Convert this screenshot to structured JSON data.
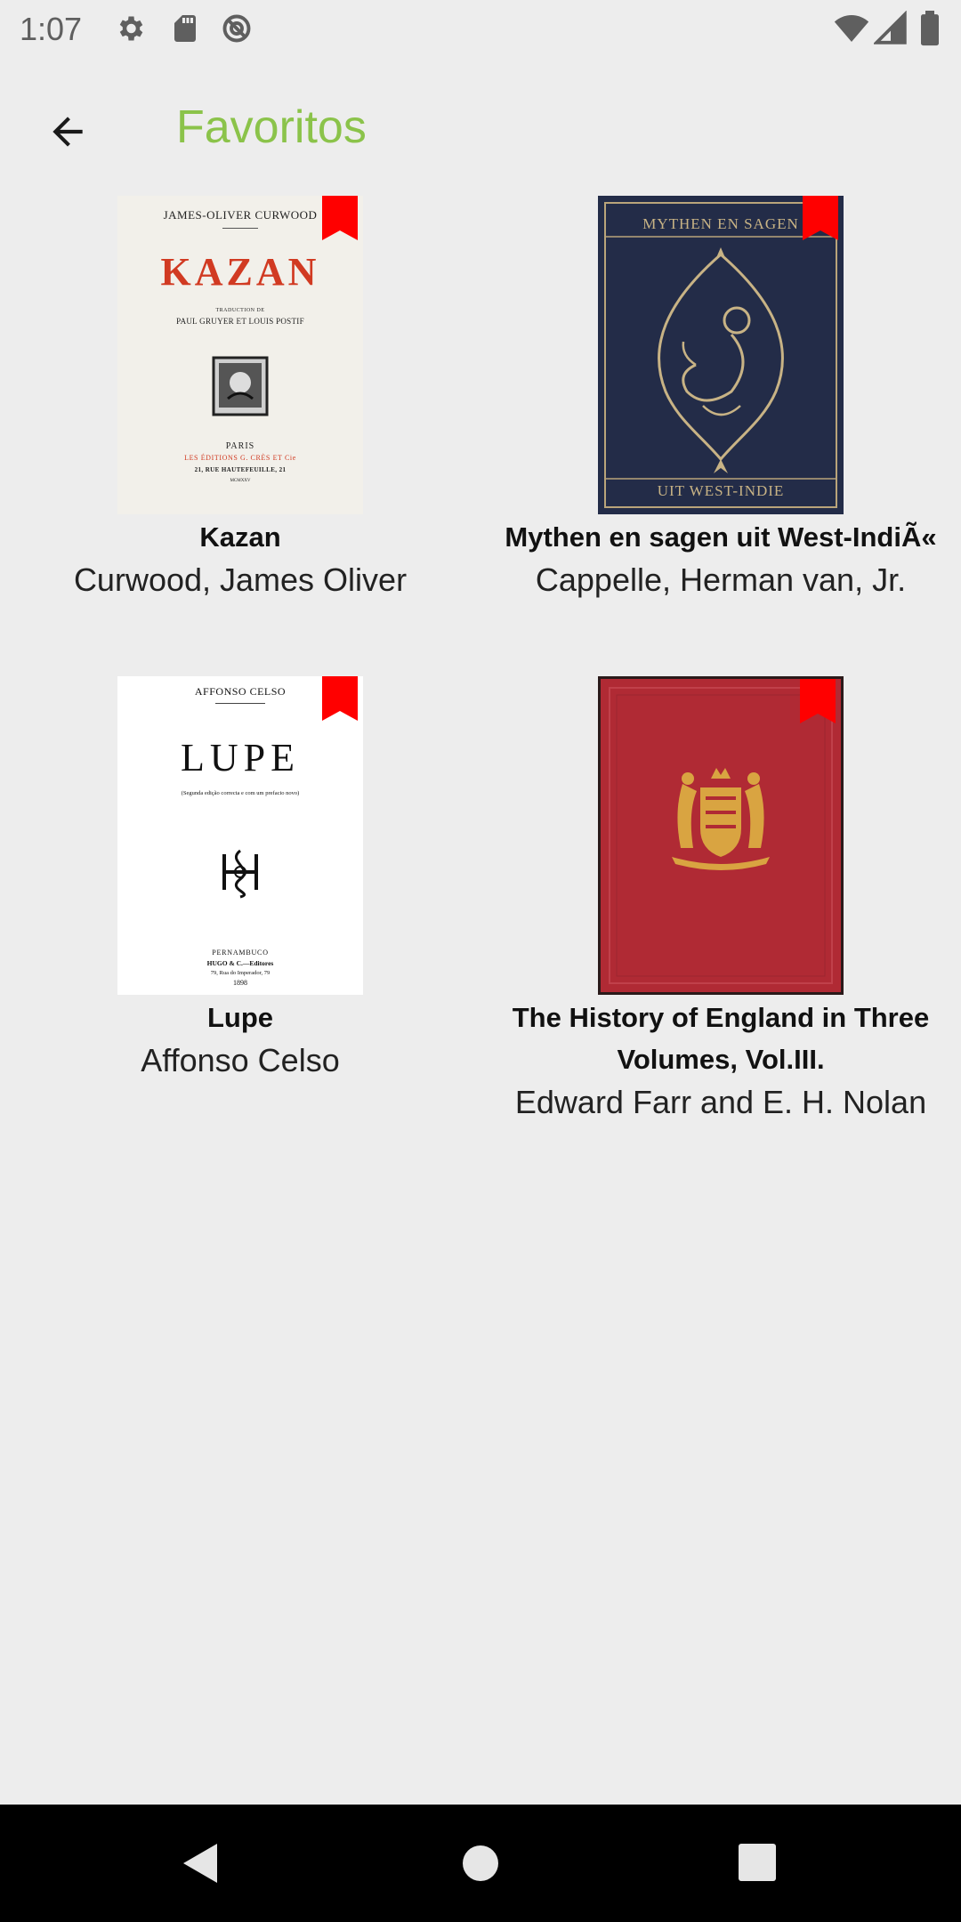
{
  "status_bar": {
    "time": "1:07",
    "icons": [
      "gear-icon",
      "sd-card-icon",
      "do-not-disturb-icon",
      "wifi-icon",
      "signal-icon",
      "battery-icon"
    ]
  },
  "app_bar": {
    "title": "Favoritos",
    "back_icon": "arrow-back-icon",
    "title_color": "#8bc34a"
  },
  "bookmark_color": "#ff0000",
  "books": [
    {
      "title": "Kazan",
      "author": "Curwood, James Oliver",
      "cover": {
        "author_line": "JAMES-OLIVER CURWOOD",
        "title_line": "KAZAN",
        "translator_1": "TRADUCTION DE",
        "translator_2": "PAUL GRUYER ET LOUIS POSTIF",
        "city": "PARIS",
        "publisher": "LES ÉDITIONS G. CRÈS ET Cie",
        "address": "21, RUE HAUTEFEUILLE, 21",
        "year": "MCMXXV"
      }
    },
    {
      "title": "Mythen en sagen uit West-IndiÃ«",
      "author": "Cappelle, Herman van, Jr.",
      "cover": {
        "top_line": "MYTHEN EN SAGEN",
        "bottom_line": "UIT WEST-INDIE"
      }
    },
    {
      "title": "Lupe",
      "author": "Affonso Celso",
      "cover": {
        "author_line": "AFFONSO CELSO",
        "title_line": "LUPE",
        "subtitle": "(Segunda edição correcta e com um prefacio novo)",
        "city": "PERNAMBUCO",
        "publisher": "HUGO & C.—Editores",
        "address": "79, Rua do Imperador, 79",
        "year": "1898"
      }
    },
    {
      "title": "The History of England in Three Volumes, Vol.III.",
      "author": "Edward Farr and E. H. Nolan",
      "cover": {}
    }
  ],
  "nav_bar": {
    "icons": [
      "back-triangle-icon",
      "home-circle-icon",
      "recents-square-icon"
    ]
  }
}
